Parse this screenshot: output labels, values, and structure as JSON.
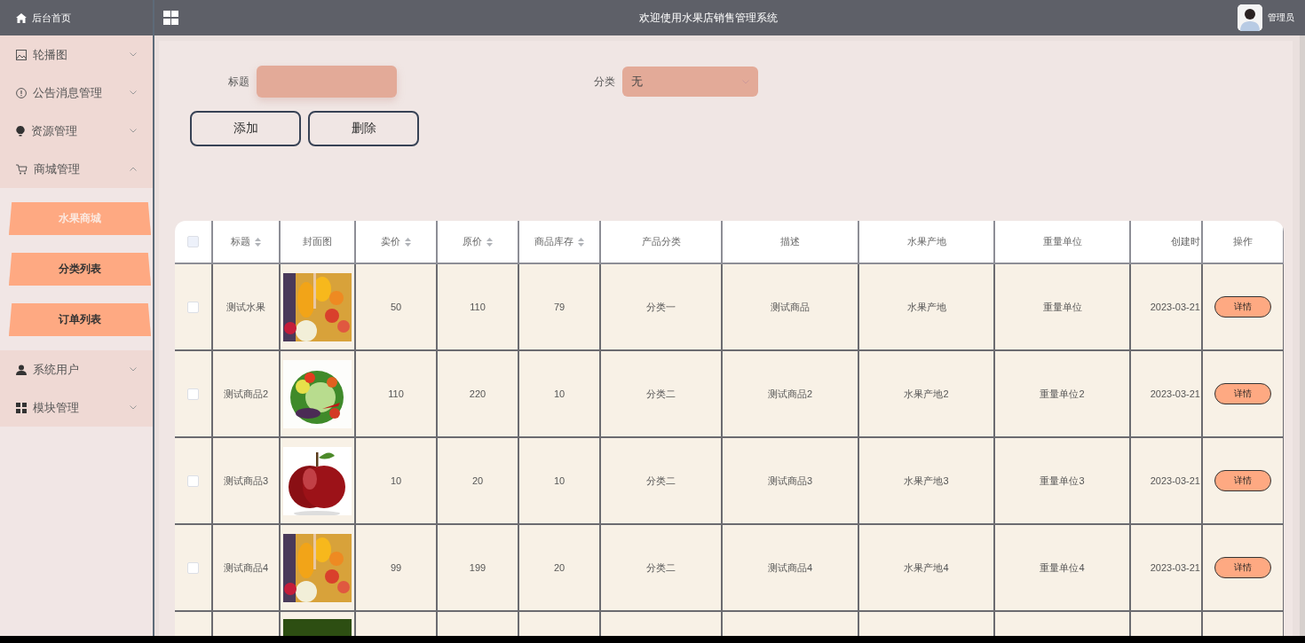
{
  "sidebar": {
    "home": {
      "label": "后台首页"
    },
    "items": [
      {
        "label": "轮播图",
        "expanded": false
      },
      {
        "label": "公告消息管理",
        "expanded": false
      },
      {
        "label": "资源管理",
        "expanded": false
      },
      {
        "label": "商城管理",
        "expanded": true,
        "children": [
          {
            "label": "水果商城",
            "selected": true
          },
          {
            "label": "分类列表",
            "selected": false
          },
          {
            "label": "订单列表",
            "selected": false
          }
        ]
      },
      {
        "label": "系统用户",
        "expanded": false
      },
      {
        "label": "模块管理",
        "expanded": false
      }
    ]
  },
  "header": {
    "title": "欢迎使用水果店销售管理系统",
    "user": "管理员"
  },
  "filters": [
    {
      "kind": "input",
      "label": "标题"
    },
    {
      "kind": "select",
      "label": "分类",
      "value": "无"
    }
  ],
  "buttons": [
    "添加",
    "删除"
  ],
  "table": {
    "header_checked": false,
    "columns": [
      {
        "label": "标题",
        "sortable": true
      },
      {
        "label": "封面图",
        "sortable": false
      },
      {
        "label": "卖价",
        "sortable": true
      },
      {
        "label": "原价",
        "sortable": true
      },
      {
        "label": "商品库存",
        "sortable": true
      },
      {
        "label": "产品分类",
        "sortable": false
      },
      {
        "label": "描述",
        "sortable": false
      },
      {
        "label": "水果产地",
        "sortable": false
      },
      {
        "label": "重量单位",
        "sortable": false
      },
      {
        "label": "创建时",
        "sortable": false
      },
      {
        "label": "操作",
        "sortable": false
      }
    ],
    "rows": [
      {
        "checked": false,
        "title": "测试水果",
        "cover": {
          "kind": "picture"
        },
        "price": "50",
        "original_price": "110",
        "stock": "79",
        "category": "分类一",
        "description": "测试商品",
        "origin": "水果产地",
        "unit": "重量单位",
        "created": "2023-03-21",
        "action": "详情"
      },
      {
        "checked": false,
        "title": "测试商品2",
        "cover": {
          "kind": "picture"
        },
        "price": "110",
        "original_price": "220",
        "stock": "10",
        "category": "分类二",
        "description": "测试商品2",
        "origin": "水果产地2",
        "unit": "重量单位2",
        "created": "2023-03-21",
        "action": "详情"
      },
      {
        "checked": false,
        "title": "测试商品3",
        "cover": {
          "kind": "picture"
        },
        "price": "10",
        "original_price": "20",
        "stock": "10",
        "category": "分类二",
        "description": "测试商品3",
        "origin": "水果产地3",
        "unit": "重量单位3",
        "created": "2023-03-21",
        "action": "详情"
      },
      {
        "checked": false,
        "title": "测试商品4",
        "cover": {
          "kind": "picture"
        },
        "price": "99",
        "original_price": "199",
        "stock": "20",
        "category": "分类二",
        "description": "测试商品4",
        "origin": "水果产地4",
        "unit": "重量单位4",
        "created": "2023-03-21",
        "action": "详情"
      },
      {
        "cover": {
          "kind": "picture"
        }
      }
    ]
  }
}
